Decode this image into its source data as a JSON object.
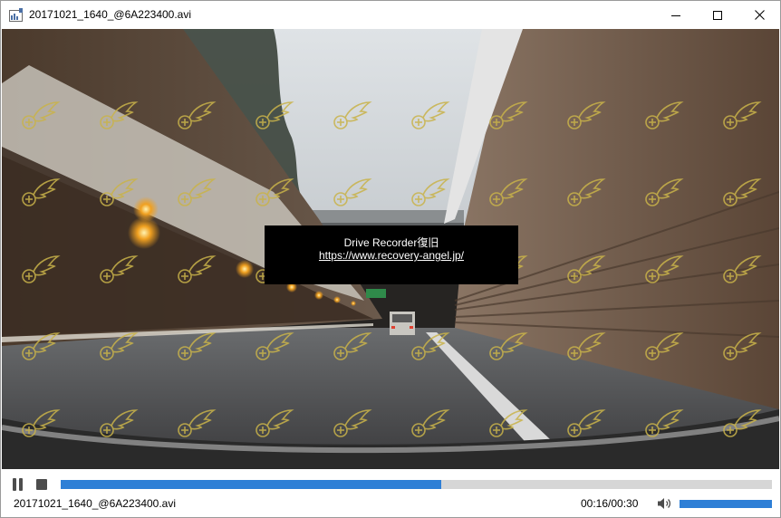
{
  "window": {
    "title": "20171021_1640_@6A223400.avi",
    "icon": "video-file-icon",
    "buttons": {
      "minimize": "minimize-icon",
      "maximize": "maximize-icon",
      "close": "close-icon"
    }
  },
  "overlay": {
    "title": "Drive Recorder復旧",
    "link": "https://www.recovery-angel.jp/"
  },
  "player": {
    "pause_icon": "pause-icon",
    "stop_icon": "stop-icon",
    "progress": 0.535,
    "filename": "20171021_1640_@6A223400.avi",
    "time": "00:16/00:30",
    "volume_icon": "speaker-icon",
    "volume": 1.0
  },
  "colors": {
    "accent": "#2e7fd6",
    "watermark": "#c9b34a"
  }
}
